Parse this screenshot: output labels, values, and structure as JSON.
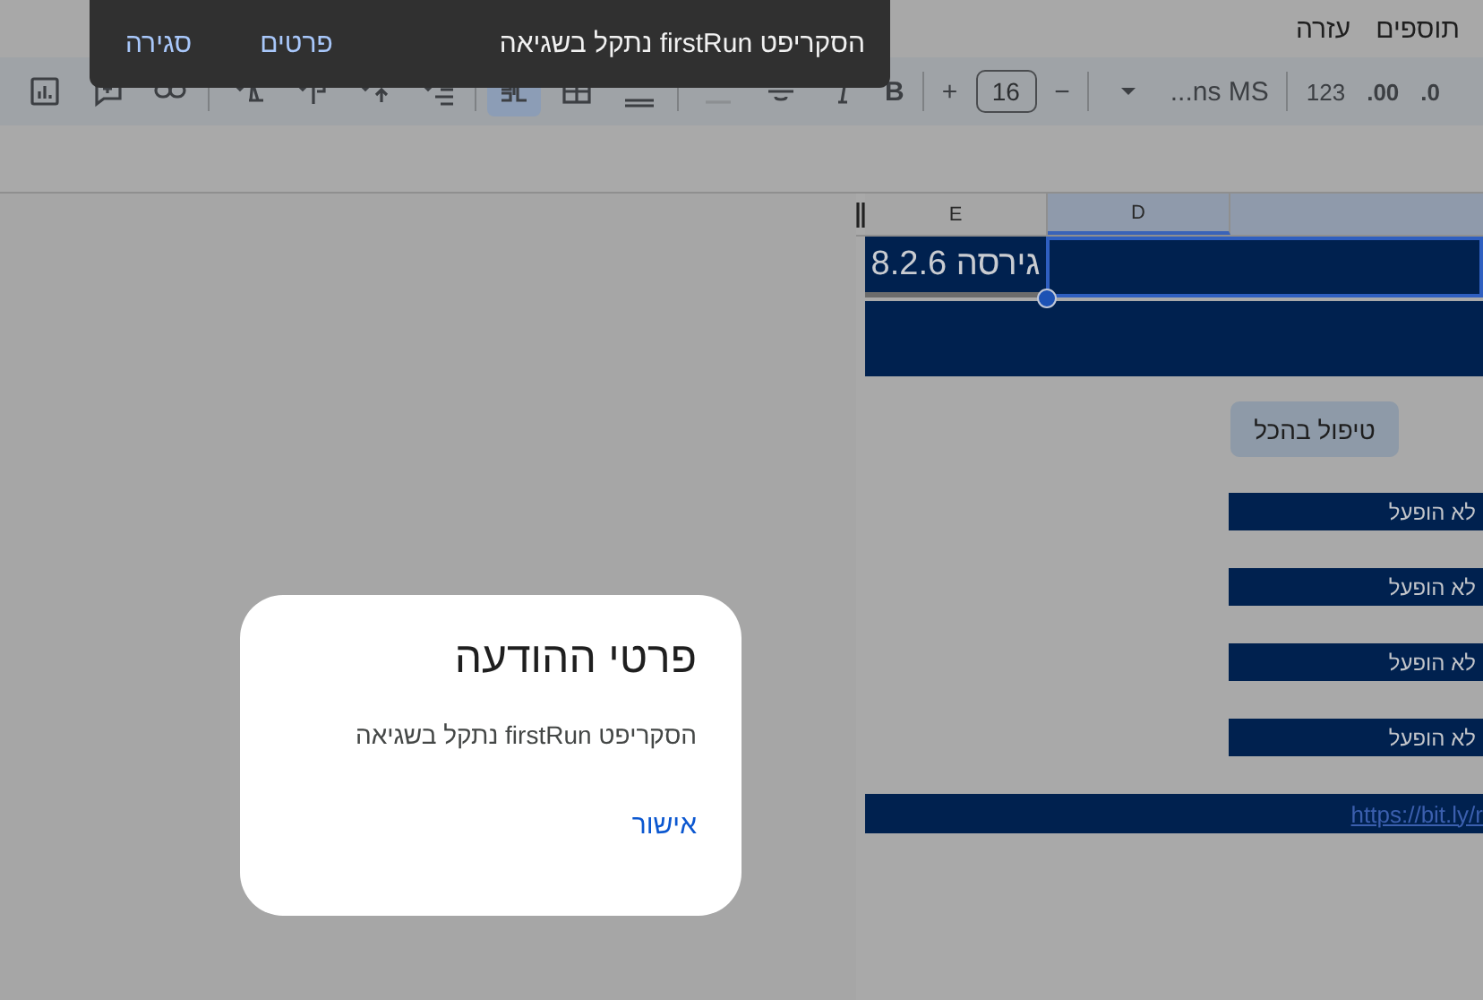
{
  "menu": [
    "תוספים",
    "עזרה"
  ],
  "toolbar": {
    "bold": "B",
    "size_increase": "+",
    "font_size": "16",
    "size_decrease": "−",
    "font": "...ns MS",
    "number_format": "123",
    "decimal_increase": ".00",
    "decimal_decrease": ".0"
  },
  "sheet": {
    "columns": [
      {
        "label": "D",
        "selected": true
      },
      {
        "label": "E",
        "selected": false
      }
    ],
    "version_cell": "גירסה 8.2.6",
    "action_button": "טיפול בהכל",
    "statuses": [
      "לא הופעל",
      "לא הופעל",
      "לא הופעל",
      "לא הופעל"
    ],
    "link": "https://bit.ly/r"
  },
  "toast": {
    "message": "הסקריפט firstRun נתקל בשגיאה",
    "actions": [
      "פרטים",
      "סגירה"
    ]
  },
  "dialog": {
    "title": "פרטי ההודעה",
    "message": "הסקריפט firstRun נתקל בשגיאה",
    "button": "אישור"
  }
}
